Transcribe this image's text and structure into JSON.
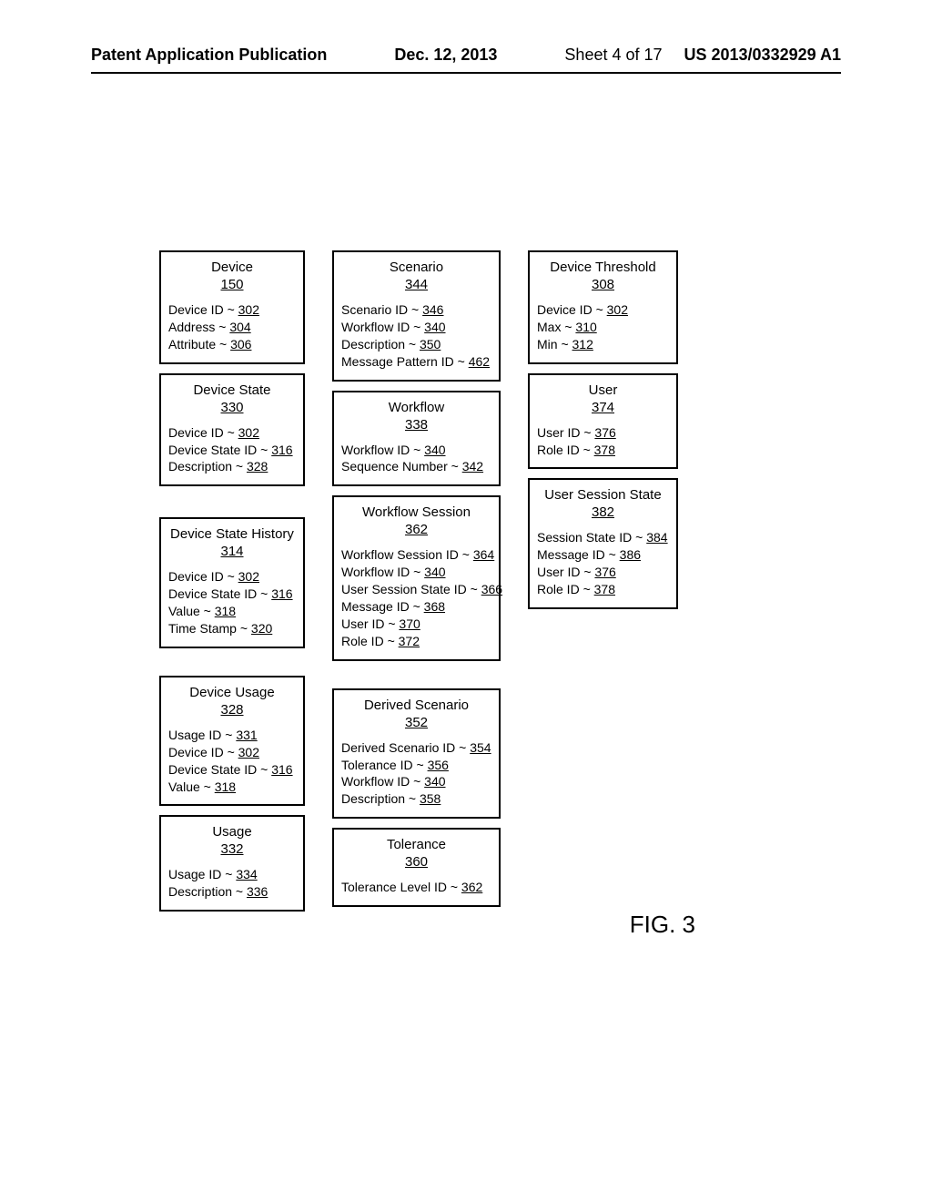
{
  "header": {
    "publication": "Patent Application Publication",
    "date": "Dec. 12, 2013",
    "sheet": "Sheet 4 of 17",
    "docnum": "US 2013/0332929 A1"
  },
  "figlabel": "FIG. 3",
  "col1": [
    {
      "title": "Device",
      "sub": "150",
      "attrs": [
        {
          "l": "Device ID ~ ",
          "r": "302"
        },
        {
          "l": "Address ~ ",
          "r": "304"
        },
        {
          "l": "Attribute ~ ",
          "r": "306"
        }
      ]
    },
    {
      "title": "Device State",
      "sub": "330",
      "attrs": [
        {
          "l": "Device ID ~ ",
          "r": "302"
        },
        {
          "l": "Device State ID ~ ",
          "r": "316"
        },
        {
          "l": "Description ~ ",
          "r": "328"
        }
      ]
    },
    {
      "title": "Device State History",
      "sub": "314",
      "attrs": [
        {
          "l": "Device ID ~ ",
          "r": "302"
        },
        {
          "l": "Device State ID ~ ",
          "r": "316"
        },
        {
          "l": "Value ~ ",
          "r": "318"
        },
        {
          "l": "Time Stamp ~ ",
          "r": "320"
        }
      ]
    },
    {
      "title": "Device Usage",
      "sub": "328",
      "attrs": [
        {
          "l": "Usage ID ~ ",
          "r": "331"
        },
        {
          "l": "Device ID ~ ",
          "r": "302"
        },
        {
          "l": "Device State ID ~ ",
          "r": "316"
        },
        {
          "l": "Value ~ ",
          "r": "318"
        }
      ]
    },
    {
      "title": "Usage",
      "sub": "332",
      "attrs": [
        {
          "l": "Usage ID ~ ",
          "r": "334"
        },
        {
          "l": "Description ~ ",
          "r": "336"
        }
      ]
    }
  ],
  "col2": [
    {
      "title": "Scenario",
      "sub": "344",
      "attrs": [
        {
          "l": "Scenario ID ~ ",
          "r": "346"
        },
        {
          "l": "Workflow ID ~ ",
          "r": "340"
        },
        {
          "l": "Description ~ ",
          "r": "350"
        },
        {
          "l": "Message Pattern ID ~ ",
          "r": "462"
        }
      ]
    },
    {
      "title": "Workflow",
      "sub": "338",
      "attrs": [
        {
          "l": "Workflow ID ~ ",
          "r": "340"
        },
        {
          "l": "Sequence Number ~ ",
          "r": "342"
        }
      ]
    },
    {
      "title": "Workflow Session",
      "sub": "362",
      "attrs": [
        {
          "l": "Workflow Session ID ~ ",
          "r": "364"
        },
        {
          "l": "Workflow ID ~ ",
          "r": "340"
        },
        {
          "l": "User Session State ID ~ ",
          "r": "366"
        },
        {
          "l": "Message ID ~ ",
          "r": "368"
        },
        {
          "l": "User ID ~ ",
          "r": "370"
        },
        {
          "l": "Role ID ~ ",
          "r": "372"
        }
      ]
    },
    {
      "title": "Derived Scenario",
      "sub": "352",
      "attrs": [
        {
          "l": "Derived Scenario ID ~ ",
          "r": "354"
        },
        {
          "l": "Tolerance ID ~ ",
          "r": "356"
        },
        {
          "l": "Workflow ID ~ ",
          "r": "340"
        },
        {
          "l": "Description ~ ",
          "r": "358"
        }
      ]
    },
    {
      "title": "Tolerance",
      "sub": "360",
      "attrs": [
        {
          "l": "Tolerance Level ID ~ ",
          "r": "362"
        }
      ]
    }
  ],
  "col3": [
    {
      "title": "Device Threshold",
      "sub": "308",
      "attrs": [
        {
          "l": "Device ID ~ ",
          "r": "302"
        },
        {
          "l": "Max ~ ",
          "r": "310"
        },
        {
          "l": "Min ~ ",
          "r": "312"
        }
      ]
    },
    {
      "title": "User",
      "sub": "374",
      "attrs": [
        {
          "l": "User ID ~ ",
          "r": "376"
        },
        {
          "l": "Role ID ~ ",
          "r": "378"
        }
      ]
    },
    {
      "title": "User Session State",
      "sub": "382",
      "attrs": [
        {
          "l": "Session State ID ~ ",
          "r": "384"
        },
        {
          "l": "Message ID ~ ",
          "r": "386"
        },
        {
          "l": "User ID ~ ",
          "r": "376"
        },
        {
          "l": "Role ID ~ ",
          "r": "378"
        }
      ]
    }
  ]
}
